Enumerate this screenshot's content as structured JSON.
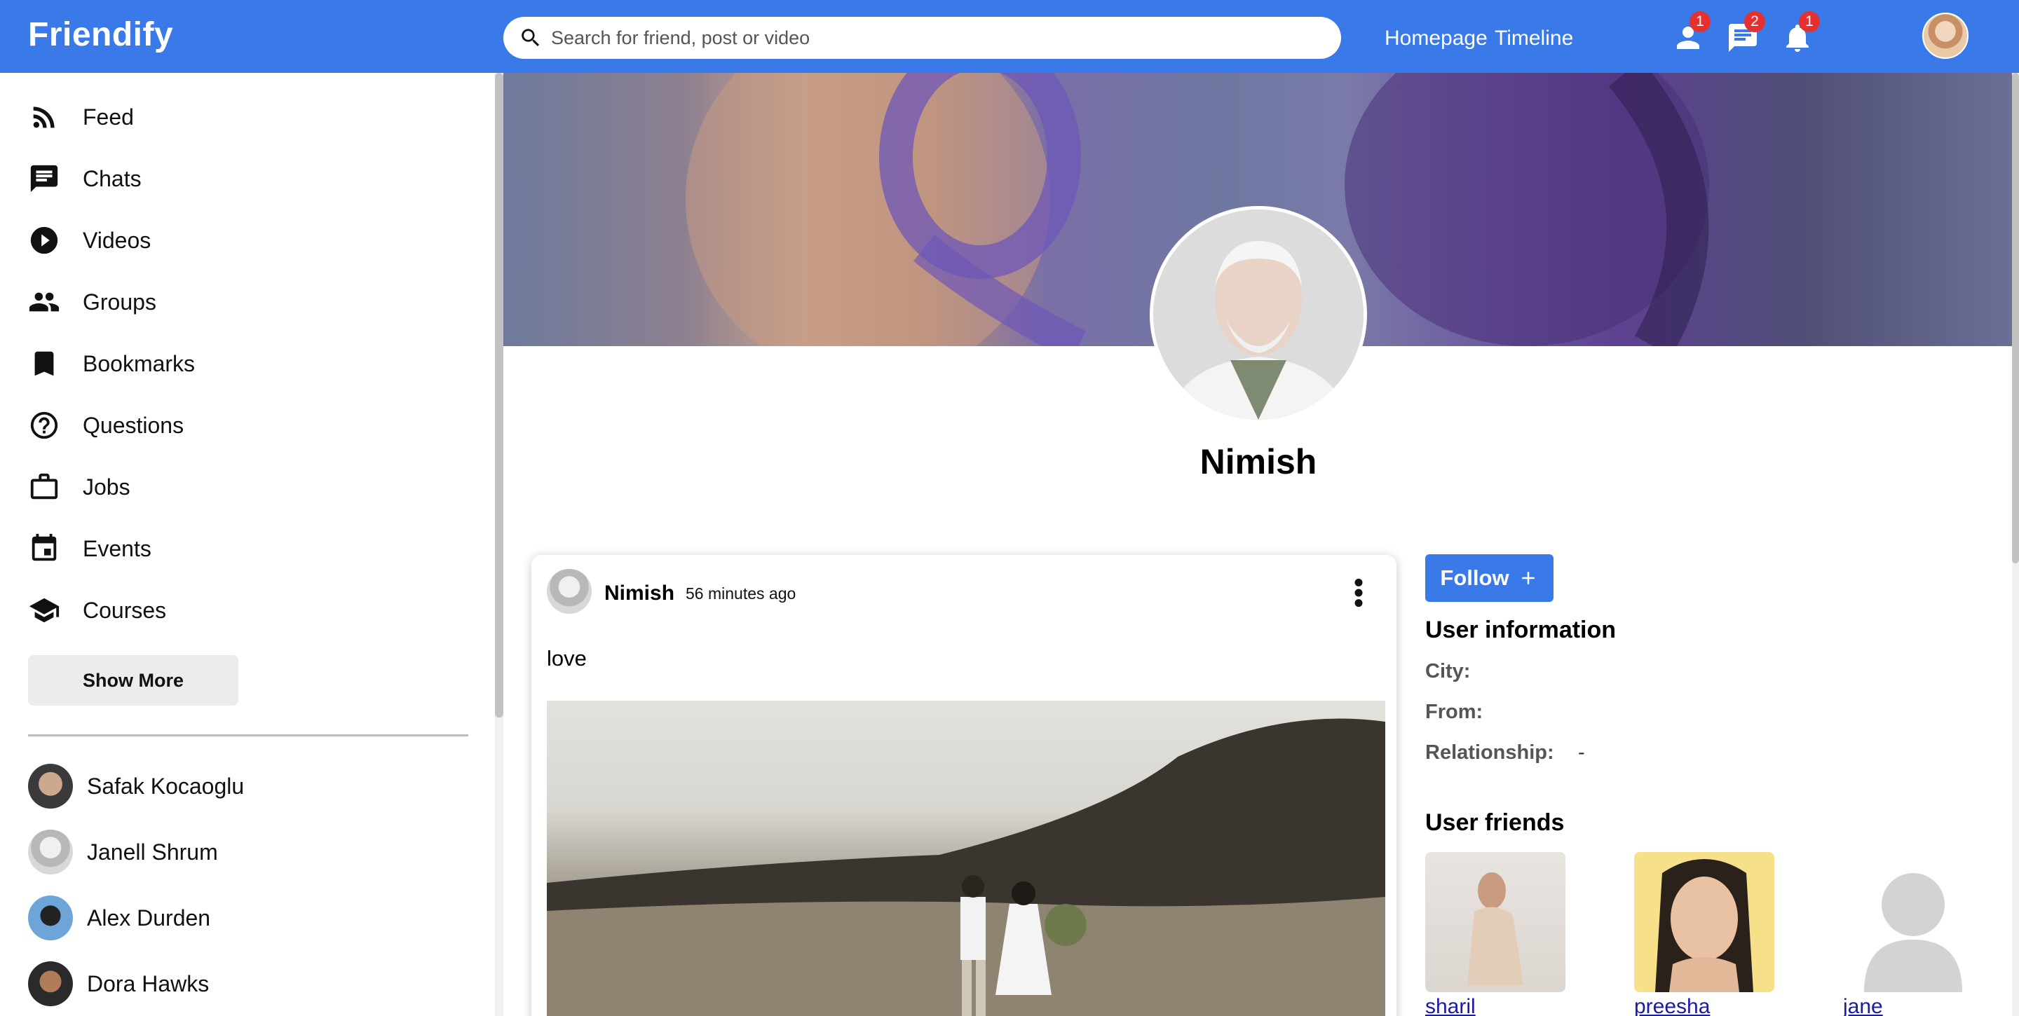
{
  "app": {
    "brand": "Friendify"
  },
  "search": {
    "placeholder": "Search for friend, post or video"
  },
  "topnav": {
    "links": [
      "Homepage",
      "Timeline"
    ]
  },
  "notifications": {
    "friend_requests": {
      "icon": "person-icon",
      "count": "1"
    },
    "messages": {
      "icon": "chat-icon",
      "count": "2"
    },
    "alerts": {
      "icon": "bell-icon",
      "count": "1"
    }
  },
  "sidebar": {
    "items": [
      {
        "label": "Feed",
        "icon": "rss-feed-icon"
      },
      {
        "label": "Chats",
        "icon": "chat-icon"
      },
      {
        "label": "Videos",
        "icon": "play-circle-icon"
      },
      {
        "label": "Groups",
        "icon": "group-icon"
      },
      {
        "label": "Bookmarks",
        "icon": "bookmark-icon"
      },
      {
        "label": "Questions",
        "icon": "help-circle-icon"
      },
      {
        "label": "Jobs",
        "icon": "briefcase-icon"
      },
      {
        "label": "Events",
        "icon": "calendar-icon"
      },
      {
        "label": "Courses",
        "icon": "school-icon"
      }
    ],
    "show_more": "Show More",
    "friends": [
      "Safak Kocaoglu",
      "Janell Shrum",
      "Alex Durden",
      "Dora Hawks"
    ]
  },
  "profile": {
    "name": "Nimish"
  },
  "post": {
    "author": "Nimish",
    "time": "56 minutes ago",
    "text": "love"
  },
  "info": {
    "follow": "Follow",
    "title": "User information",
    "city_label": "City:",
    "city_value": "",
    "from_label": "From:",
    "from_value": "",
    "relationship_label": "Relationship:",
    "relationship_value": "-"
  },
  "user_friends": {
    "title": "User friends",
    "items": [
      "sharil",
      "preesha",
      "jane"
    ]
  },
  "colors": {
    "primary": "#3a7ae8",
    "badge": "#e53030",
    "link": "#1a1aa6"
  }
}
